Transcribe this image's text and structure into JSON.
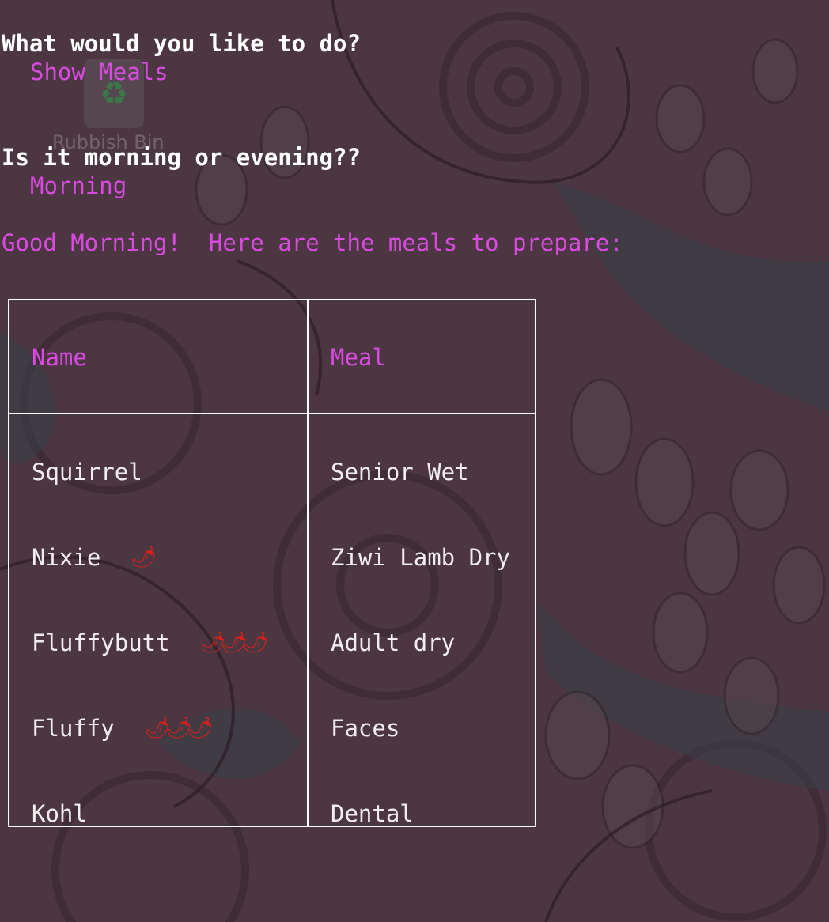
{
  "prompts": {
    "q1": "What would you like to do?",
    "a1": "Show Meals",
    "q2": "Is it morning or evening??",
    "a2": "Morning",
    "message": "Good Morning!  Here are the meals to prepare:"
  },
  "desktop": {
    "icon_name": "recycle-bin-icon",
    "icon_label": "Rubbish Bin"
  },
  "table": {
    "headers": {
      "name": "Name",
      "meal": "Meal"
    },
    "rows": [
      {
        "name": "Squirrel",
        "meal": "Senior Wet",
        "spice": 0
      },
      {
        "name": "Nixie",
        "meal": "Ziwi Lamb Dry",
        "spice": 1
      },
      {
        "name": "Fluffybutt",
        "meal": "Adult dry",
        "spice": 3
      },
      {
        "name": "Fluffy",
        "meal": "Faces",
        "spice": 3
      },
      {
        "name": "Kohl",
        "meal": "Dental",
        "spice": 0
      }
    ]
  },
  "icons": {
    "spice": "chili-pepper-icon"
  },
  "colors": {
    "accent": "#d94ae0",
    "text": "#ffffff",
    "background": "#4a3440",
    "chili": "#d8201a"
  }
}
